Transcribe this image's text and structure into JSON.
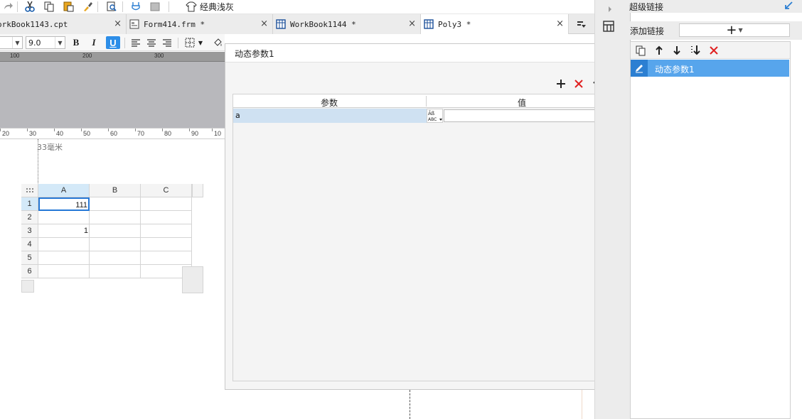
{
  "toolbar": {
    "theme_label": "经典浅灰",
    "icons": [
      "redo-icon",
      "cut-icon",
      "copy-icon",
      "paste-icon",
      "format-brush-icon",
      "preview-icon",
      "plug-icon",
      "image-icon",
      "theme-icon"
    ]
  },
  "tabs": [
    {
      "label": "orkBook1143.cpt",
      "close": "×",
      "icon": "none"
    },
    {
      "label": "Form414.frm *",
      "close": "×",
      "icon": "form-icon"
    },
    {
      "label": "WorkBook1144 *",
      "close": "×",
      "icon": "grid-icon"
    },
    {
      "label": "Poly3 *",
      "close": "×",
      "icon": "grid-icon",
      "active": true
    }
  ],
  "format_bar": {
    "font_size": "9.0",
    "bold_label": "B",
    "italic_label": "I",
    "underline_label": "U"
  },
  "ruler_top": [
    "100",
    "200",
    "300"
  ],
  "ruler_second": [
    "20",
    "30",
    "40",
    "50",
    "60",
    "70",
    "80",
    "90",
    "10"
  ],
  "page_margin_label": "33毫米",
  "sheet": {
    "columns": [
      "A",
      "B",
      "C"
    ],
    "rows": [
      {
        "num": "1",
        "cells": [
          "111",
          "",
          ""
        ]
      },
      {
        "num": "2",
        "cells": [
          "",
          "",
          ""
        ]
      },
      {
        "num": "3",
        "cells": [
          "1",
          "",
          ""
        ]
      },
      {
        "num": "4",
        "cells": [
          "",
          "",
          ""
        ]
      },
      {
        "num": "5",
        "cells": [
          "",
          "",
          ""
        ]
      },
      {
        "num": "6",
        "cells": [
          "",
          "",
          ""
        ]
      }
    ]
  },
  "dialog": {
    "title": "动态参数1",
    "table_headers": {
      "param": "参数",
      "value": "值"
    },
    "rows": [
      {
        "param": "a",
        "type_icon": "abc-type-icon",
        "value": ""
      }
    ]
  },
  "right_panel": {
    "title": "超级链接",
    "add_link_label": "添加链接",
    "add_button": "+",
    "items": [
      {
        "label": "动态参数1",
        "selected": true
      }
    ]
  },
  "colors": {
    "accent": "#2d8ee8",
    "selected_item": "#57a5ec",
    "delete_red": "#e02020"
  }
}
